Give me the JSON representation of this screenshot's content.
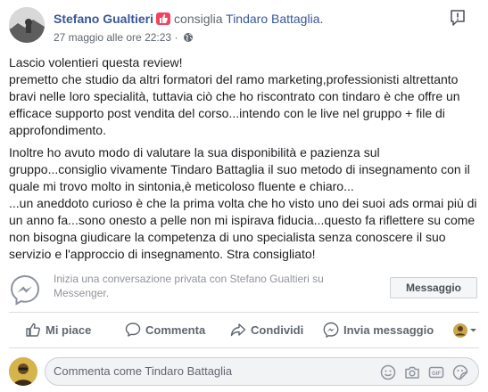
{
  "header": {
    "author": "Stefano Gualtieri",
    "verb": "consiglia",
    "page": "Tindaro Battaglia.",
    "timestamp": "27 maggio alle ore 22:23",
    "separator": "·"
  },
  "post": {
    "paragraphs": [
      "Lascio volentieri questa review!\npremetto che studio da altri formatori del ramo marketing,professionisti altrettanto bravi nelle loro specialità, tuttavia ciò che ho riscontrato con tindaro è che offre un efficace supporto post vendita del corso...intendo con le live nel gruppo + file di approfondimento.",
      "Inoltre ho avuto modo di valutare la sua disponibilità e pazienza sul gruppo...consiglio vivamente Tindaro Battaglia il suo metodo di insegnamento con il quale mi trovo molto in sintonia,è meticoloso fluente e chiaro...\n...un aneddoto curioso è che la prima volta che ho visto uno dei suoi ads ormai più di un anno fa...sono onesto a pelle non mi ispirava fiducia...questo fa riflettere su come non bisogna giudicare la competenza di uno specialista senza conoscere il suo servizio e l'approccio di insegnamento. Stra consigliato!"
    ]
  },
  "messenger": {
    "prompt": "Inizia una conversazione privata con Stefano Gualtieri su Messenger.",
    "button_label": "Messaggio"
  },
  "actions": {
    "like": "Mi piace",
    "comment": "Commenta",
    "share": "Condividi",
    "send": "Invia messaggio"
  },
  "comment": {
    "placeholder": "Commenta come Tindaro Battaglia"
  },
  "icons": {
    "recommend": "recommend-badge-icon",
    "globe": "globe-icon",
    "report": "report-icon",
    "messenger": "messenger-icon",
    "like": "thumbs-up-icon",
    "comment": "speech-bubble-icon",
    "share": "share-arrow-icon",
    "send": "messenger-send-icon",
    "emoji": "emoji-icon",
    "camera": "camera-icon",
    "gif": "gif-icon",
    "sticker": "sticker-icon"
  },
  "colors": {
    "link": "#385898",
    "recommend_badge": "#f3425f",
    "muted": "#606770",
    "divider": "#dadde1"
  }
}
